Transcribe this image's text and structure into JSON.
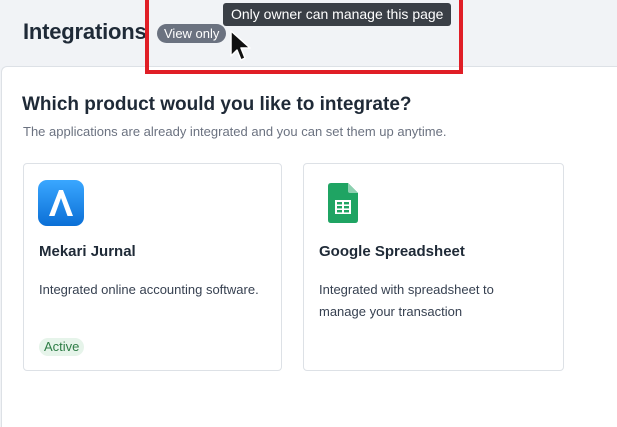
{
  "header": {
    "title": "Integrations",
    "badge": "View only",
    "tooltip": "Only owner can manage this page"
  },
  "section": {
    "title": "Which product would you like to integrate?",
    "subtitle": "The applications are already integrated and you can set them up anytime."
  },
  "cards": [
    {
      "name": "Mekari Jurnal",
      "description": "Integrated online accounting software.",
      "status": "Active",
      "icon": "mekari-jurnal-logo-icon",
      "icon_color": "#1e8ff0"
    },
    {
      "name": "Google Spreadsheet",
      "description": "Integrated with spreadsheet to manage your transaction",
      "icon": "google-sheets-icon",
      "icon_color": "#1fa463"
    }
  ],
  "colors": {
    "highlight": "#e01e26",
    "badge_bg": "#6b7280",
    "tooltip_bg": "#3a3f46",
    "active_bg": "#e6f4ea",
    "active_text": "#2e7d46"
  }
}
